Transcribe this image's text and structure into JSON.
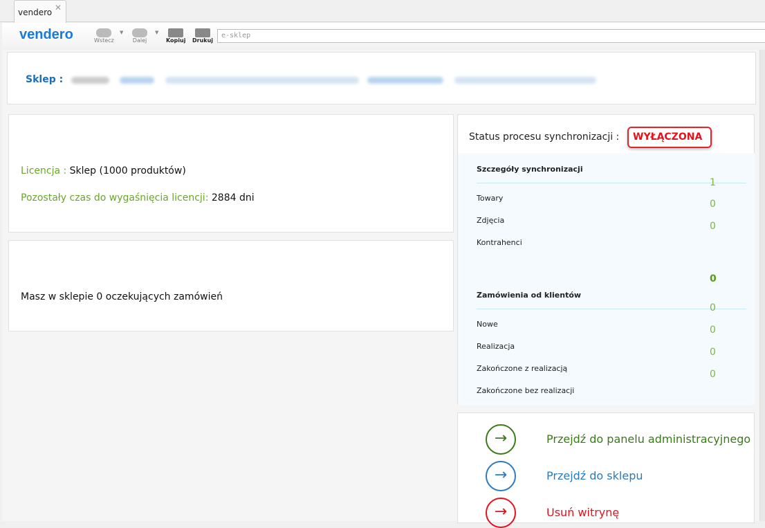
{
  "tab": {
    "title": "vendero"
  },
  "toolbar": {
    "logo": "vendero",
    "back": "Wstecz",
    "forward": "Dalej",
    "copy": "Kopiuj",
    "print": "Drukuj",
    "address": "e-sklep"
  },
  "shop": {
    "label": "Sklep :"
  },
  "license": {
    "label": "Licencja :",
    "value": "Sklep (1000 produktów)",
    "remaining_label": "Pozostały czas do wygaśnięcia licencji:",
    "remaining_value": "2884 dni"
  },
  "orders": {
    "text": "Masz w sklepie 0 oczekujących zamówień"
  },
  "sync": {
    "status_label": "Status procesu synchronizacji :",
    "status": "WYŁĄCZONA",
    "status_color": "#e8101a",
    "details_title": "Szczegóły synchronizacji",
    "details": [
      {
        "label": "Towary",
        "value": "1"
      },
      {
        "label": "Zdjęcia",
        "value": "0"
      },
      {
        "label": "Kontrahenci",
        "value": "0"
      }
    ],
    "orders_total": "0",
    "orders_title": "Zamówienia od klientów",
    "orders_items": [
      {
        "label": "Nowe",
        "value": "0"
      },
      {
        "label": "Realizacja",
        "value": "0"
      },
      {
        "label": "Zakończone z realizacją",
        "value": "0"
      },
      {
        "label": "Zakończone bez realizacji",
        "value": "0"
      }
    ]
  },
  "actions": [
    {
      "label": "Przejdź do panelu administracyjnego",
      "color": "#3a7a1a"
    },
    {
      "label": "Przejdź do sklepu",
      "color": "#2a7ac0"
    },
    {
      "label": "Usuń witrynę",
      "color": "#e8101a"
    }
  ]
}
